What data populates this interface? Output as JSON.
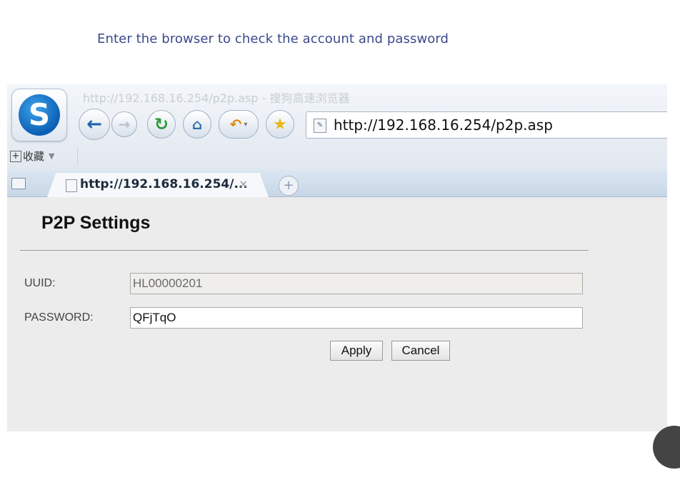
{
  "caption": "Enter the browser to check the account and password",
  "browser": {
    "window_title": "http://192.168.16.254/p2p.asp - 搜狗高速浏览器",
    "address_url": "http://192.168.16.254/p2p.asp",
    "favorites_label": "收藏",
    "tab_title": "http://192.168.16.254/...",
    "tab_close": "×",
    "new_tab": "+"
  },
  "icons": {
    "logo": "sogou-logo-icon",
    "back": "back-arrow-icon",
    "forward": "forward-arrow-icon",
    "refresh": "refresh-icon",
    "home": "home-icon",
    "undo": "undo-icon",
    "favorite": "star-icon",
    "page": "page-icon"
  },
  "colors": {
    "caption": "#3a4a8a",
    "logo_blue": "#0a5fb5",
    "refresh_green": "#2e9b3a",
    "home_blue": "#2f6fb5",
    "undo_orange": "#e08a12",
    "star_gold": "#e8b81a"
  },
  "form": {
    "title": "P2P Settings",
    "uuid_label": "UUID:",
    "uuid_value": "HL00000201",
    "password_label": "PASSWORD:",
    "password_value": "QFjTqO",
    "apply_label": "Apply",
    "cancel_label": "Cancel"
  }
}
